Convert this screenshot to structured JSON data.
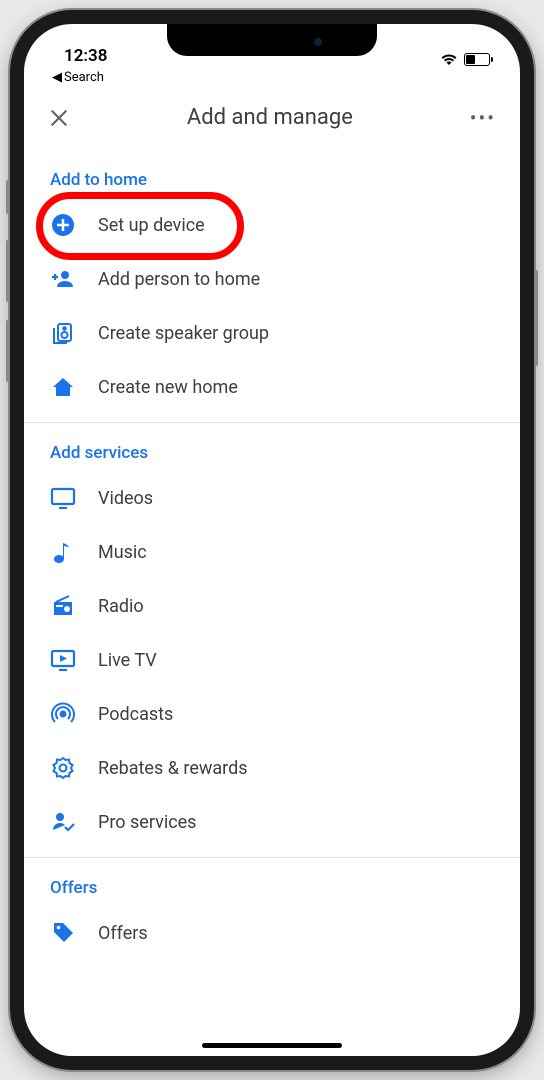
{
  "status": {
    "time": "12:38",
    "back_label": "Search"
  },
  "header": {
    "title": "Add and manage"
  },
  "sections": {
    "add_to_home": {
      "title": "Add to home",
      "items": [
        {
          "label": "Set up device"
        },
        {
          "label": "Add person to home"
        },
        {
          "label": "Create speaker group"
        },
        {
          "label": "Create new home"
        }
      ]
    },
    "add_services": {
      "title": "Add services",
      "items": [
        {
          "label": "Videos"
        },
        {
          "label": "Music"
        },
        {
          "label": "Radio"
        },
        {
          "label": "Live TV"
        },
        {
          "label": "Podcasts"
        },
        {
          "label": "Rebates & rewards"
        },
        {
          "label": "Pro services"
        }
      ]
    },
    "offers": {
      "title": "Offers",
      "items": [
        {
          "label": "Offers"
        }
      ]
    }
  }
}
